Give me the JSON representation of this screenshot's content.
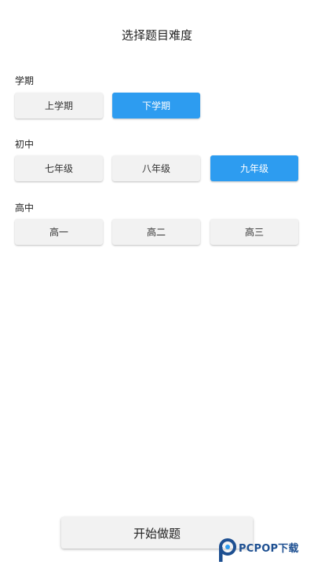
{
  "header": {
    "title": "选择题目难度"
  },
  "sections": [
    {
      "label": "学期",
      "options": [
        "上学期",
        "下学期"
      ],
      "selected": "下学期"
    },
    {
      "label": "初中",
      "options": [
        "七年级",
        "八年级",
        "九年级"
      ],
      "selected": "九年级"
    },
    {
      "label": "高中",
      "options": [
        "高一",
        "高二",
        "高三"
      ],
      "selected": null
    }
  ],
  "footer": {
    "start_label": "开始做题"
  },
  "watermark": {
    "brand": "PCPOP下载",
    "icon": "pcpop-logo-icon"
  },
  "colors": {
    "selected": "#2d9cf0",
    "unselected": "#f2f2f2",
    "text": "#222222"
  }
}
